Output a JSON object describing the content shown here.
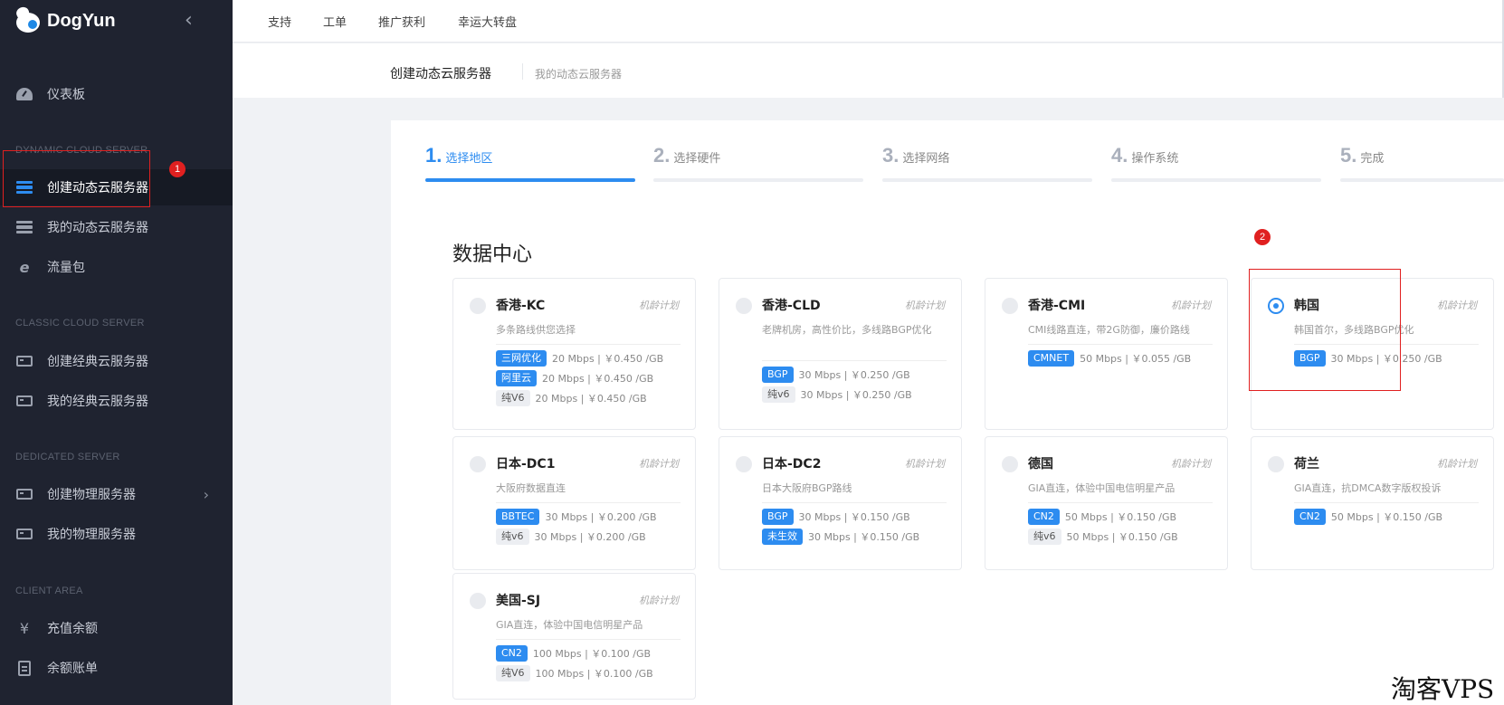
{
  "logo": {
    "text": "DogYun"
  },
  "sidebar": {
    "dashboard": "仪表板",
    "section_dynamic": "DYNAMIC CLOUD SERVER",
    "create_dynamic": "创建动态云服务器",
    "my_dynamic": "我的动态云服务器",
    "traffic": "流量包",
    "section_classic": "CLASSIC CLOUD SERVER",
    "create_classic": "创建经典云服务器",
    "my_classic": "我的经典云服务器",
    "section_dedicated": "DEDICATED SERVER",
    "create_physical": "创建物理服务器",
    "my_physical": "我的物理服务器",
    "section_client": "CLIENT AREA",
    "recharge": "充值余额",
    "bill": "余额账单"
  },
  "topbar": {
    "links": [
      "支持",
      "工单",
      "推广获利",
      "幸运大转盘"
    ]
  },
  "subbar": {
    "current": "创建动态云服务器",
    "other": "我的动态云服务器"
  },
  "steps": [
    {
      "num": "1.",
      "label": "选择地区"
    },
    {
      "num": "2.",
      "label": "选择硬件"
    },
    {
      "num": "3.",
      "label": "选择网络"
    },
    {
      "num": "4.",
      "label": "操作系统"
    },
    {
      "num": "5.",
      "label": "完成"
    }
  ],
  "datacenter_title": "数据中心",
  "plan_label": "机龄计划",
  "cards": [
    {
      "name": "香港-KC",
      "desc": "多条路线供您选择",
      "checked": false,
      "lines": [
        {
          "tag": "三网优化",
          "style": "blue",
          "text": "20 Mbps | ￥0.450 /GB"
        },
        {
          "tag": "阿里云",
          "style": "blue",
          "text": "20 Mbps | ￥0.450 /GB"
        },
        {
          "tag": "纯V6",
          "style": "gray",
          "text": "20 Mbps | ￥0.450 /GB"
        }
      ]
    },
    {
      "name": "香港-CLD",
      "desc": "老牌机房，高性价比，多线路BGP优化",
      "checked": false,
      "lines": [
        {
          "tag": "BGP",
          "style": "blue",
          "text": "30 Mbps | ￥0.250 /GB"
        },
        {
          "tag": "纯v6",
          "style": "gray",
          "text": "30 Mbps | ￥0.250 /GB"
        }
      ]
    },
    {
      "name": "香港-CMI",
      "desc": "CMI线路直连，带2G防御，廉价路线",
      "checked": false,
      "lines": [
        {
          "tag": "CMNET",
          "style": "blue",
          "text": "50 Mbps | ￥0.055 /GB"
        }
      ]
    },
    {
      "name": "韩国",
      "desc": "韩国首尔，多线路BGP优化",
      "checked": true,
      "lines": [
        {
          "tag": "BGP",
          "style": "blue",
          "text": "30 Mbps | ￥0.250 /GB"
        }
      ]
    },
    {
      "name": "日本-DC1",
      "desc": "大阪府数据直连",
      "checked": false,
      "lines": [
        {
          "tag": "BBTEC",
          "style": "blue",
          "text": "30 Mbps | ￥0.200 /GB"
        },
        {
          "tag": "纯v6",
          "style": "gray",
          "text": "30 Mbps | ￥0.200 /GB"
        }
      ]
    },
    {
      "name": "日本-DC2",
      "desc": "日本大阪府BGP路线",
      "checked": false,
      "lines": [
        {
          "tag": "BGP",
          "style": "blue",
          "text": "30 Mbps | ￥0.150 /GB"
        },
        {
          "tag": "未生效",
          "style": "blue",
          "text": "30 Mbps | ￥0.150 /GB"
        }
      ]
    },
    {
      "name": "德国",
      "desc": "GIA直连，体验中国电信明星产品",
      "checked": false,
      "lines": [
        {
          "tag": "CN2",
          "style": "blue",
          "text": "50 Mbps | ￥0.150 /GB"
        },
        {
          "tag": "纯v6",
          "style": "gray",
          "text": "50 Mbps | ￥0.150 /GB"
        }
      ]
    },
    {
      "name": "荷兰",
      "desc": "GIA直连，抗DMCA数字版权投诉",
      "checked": false,
      "lines": [
        {
          "tag": "CN2",
          "style": "blue",
          "text": "50 Mbps | ￥0.150 /GB"
        }
      ]
    },
    {
      "name": "美国-SJ",
      "desc": "GIA直连，体验中国电信明星产品",
      "checked": false,
      "lines": [
        {
          "tag": "CN2",
          "style": "blue",
          "text": "100 Mbps | ￥0.100 /GB"
        },
        {
          "tag": "纯V6",
          "style": "gray",
          "text": "100 Mbps | ￥0.100 /GB"
        }
      ]
    }
  ],
  "annotations": [
    "1",
    "2"
  ],
  "watermark": "淘客VPS",
  "colors": {
    "accent": "#2d8cf0",
    "sidebar_bg": "#1f2330",
    "annotation": "#e02020"
  }
}
